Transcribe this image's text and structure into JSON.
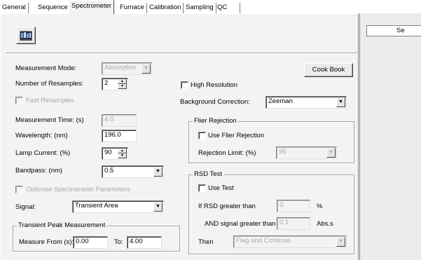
{
  "tabs": [
    "General",
    "Sequence",
    "Spectrometer",
    "Furnace",
    "Calibration",
    "Sampling",
    "QC"
  ],
  "right_panel": {
    "header": "Se"
  },
  "toolbar": {
    "icon": "spectrometer-icon"
  },
  "form": {
    "measurement_mode": {
      "label": "Measurement Mode:",
      "value": "Absorption"
    },
    "resamples": {
      "label": "Number of Resamples:",
      "value": "2"
    },
    "fast_resamples": {
      "label": "Fast Resamples"
    },
    "measurement_time": {
      "label": "Measurement Time: (s)",
      "value": "4.0"
    },
    "wavelength": {
      "label": "Wavelength: (nm)",
      "value": "196.0"
    },
    "lamp_current": {
      "label": "Lamp Current: (%)",
      "value": "90"
    },
    "bandpass": {
      "label": "Bandpass: (nm)",
      "value": "0.5"
    },
    "optimise": {
      "label": "Optimise Spectrometer Parameters"
    },
    "signal": {
      "label": "Signal:",
      "value": "Transient Area"
    },
    "cook_book": {
      "label": "Cook Book"
    },
    "high_resolution": {
      "label": "High Resolution"
    },
    "background": {
      "label": "Background Correction:",
      "value": "Zeeman"
    }
  },
  "transient": {
    "title": "Transient Peak Measurement",
    "from_label": "Measure From (s):",
    "from_value": "0.00",
    "to_label": "To:",
    "to_value": "4.00"
  },
  "flier": {
    "title": "Flier Rejection",
    "use_label": "Use Flier Rejection",
    "limit_label": "Rejection Limit: (%)",
    "limit_value": "95"
  },
  "rsd": {
    "title": "RSD Test",
    "use_label": "Use Test",
    "greater_label": "If  RSD greater than",
    "greater_value": "0",
    "greater_unit": "%",
    "signal_label": "AND signal greater than",
    "signal_value": "0.1",
    "signal_unit": "Abs.s",
    "then_label": "Then",
    "then_value": "Flag and Continue"
  }
}
